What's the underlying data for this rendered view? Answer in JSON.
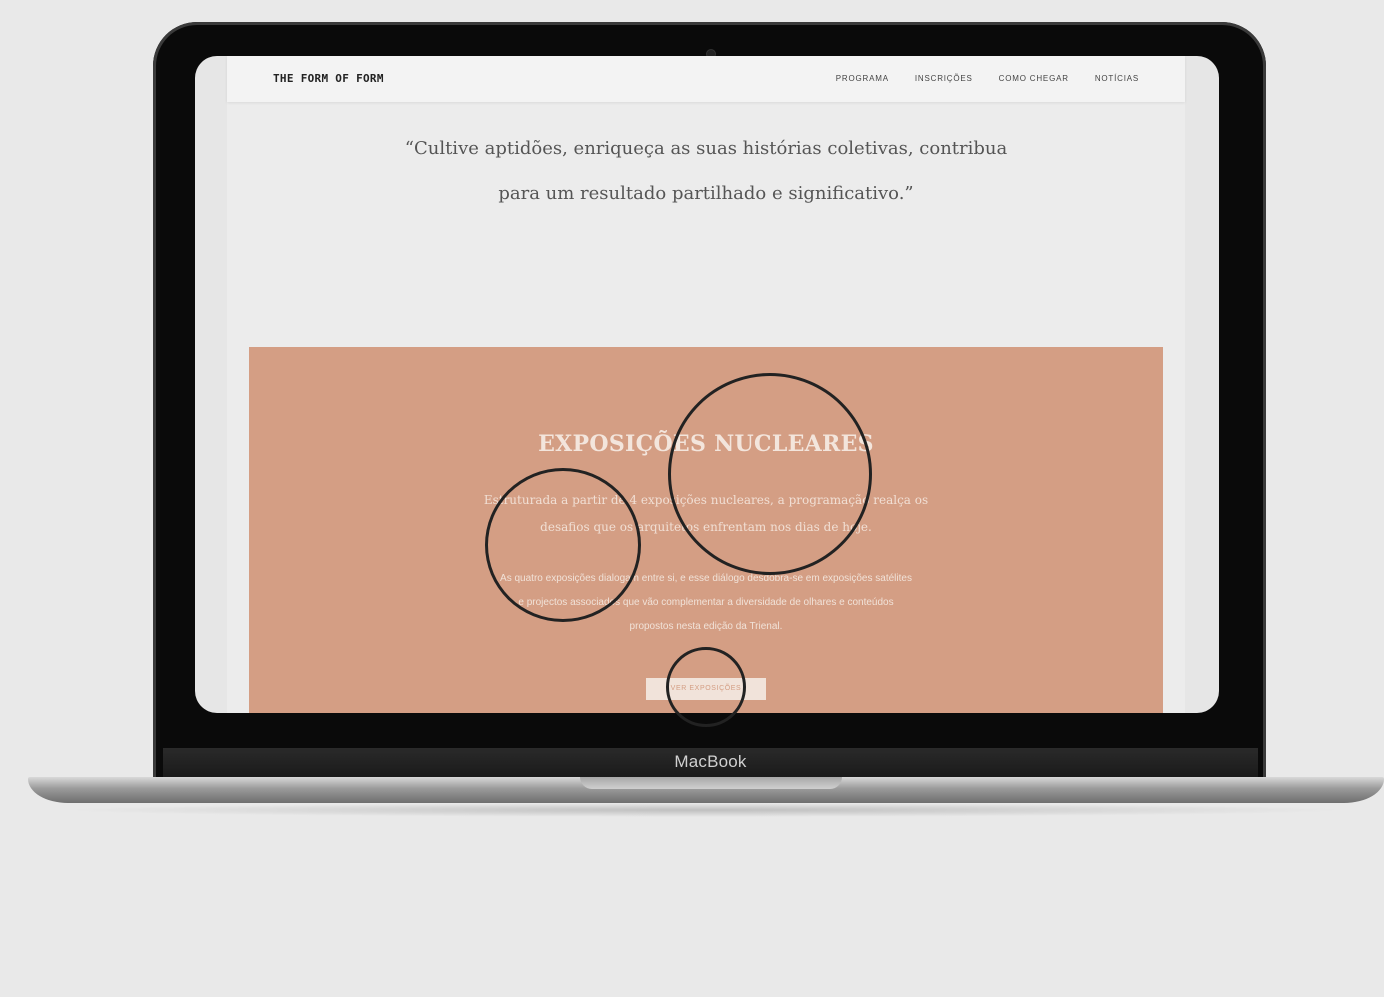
{
  "device": {
    "label": "MacBook"
  },
  "site": {
    "logo": "THE FORM OF FORM",
    "nav": [
      {
        "label": "PROGRAMA"
      },
      {
        "label": "INSCRIÇÕES"
      },
      {
        "label": "COMO CHEGAR"
      },
      {
        "label": "NOTÍCIAS"
      }
    ]
  },
  "quote": {
    "line1": "“Cultive aptidões, enriqueça as suas histórias coletivas, contribua",
    "line2": "para um resultado partilhado e significativo.”"
  },
  "exhibitions": {
    "title": "EXPOSIÇÕES NUCLEARES",
    "subtitle": "Estruturada a partir de 4 exposições nucleares, a programação realça os desafios que os arquitetos enfrentam nos dias de hoje.",
    "body": "As quatro exposições dialogam entre si, e esse diálogo desdobra-se em exposições satélites e projectos associados que vão complementar a diversidade de olhares e conteúdos propostos nesta edição da Trienal.",
    "button_label": "VER EXPOSIÇÕES"
  },
  "colors": {
    "panel": "#d49e84",
    "page_background": "#ececec",
    "annotation_ring": "#222222"
  }
}
